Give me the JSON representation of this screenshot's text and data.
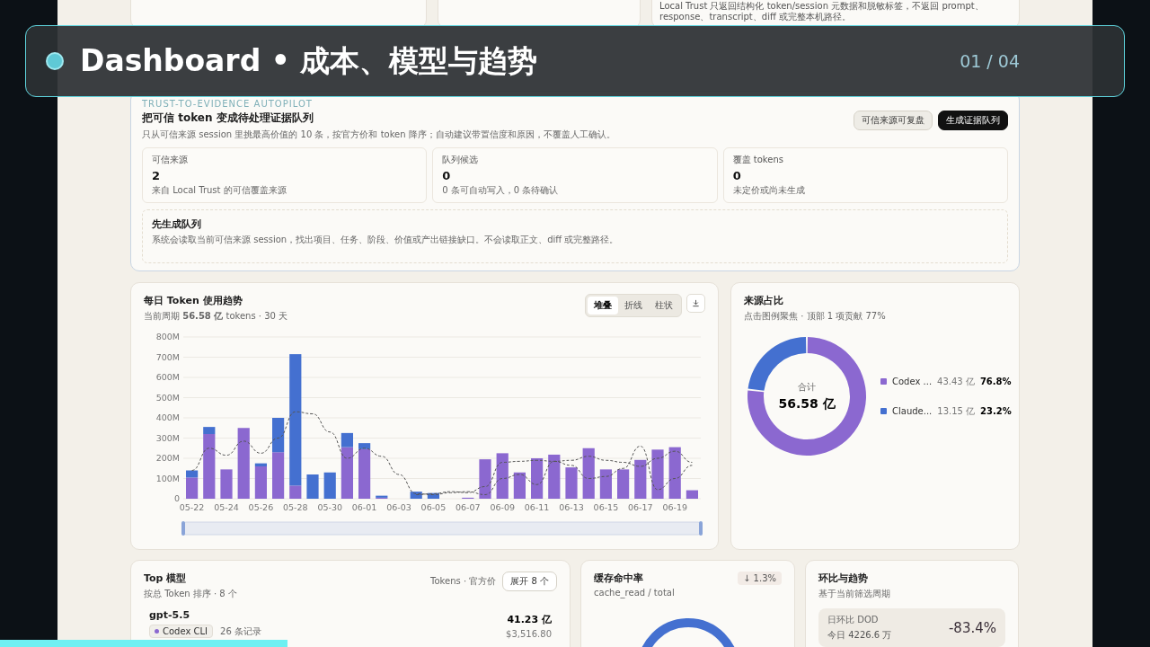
{
  "overlay": {
    "title": "Dashboard • 成本、模型与趋势",
    "counter": "01 / 04"
  },
  "top_notice": {
    "text": "Local Trust 只返回结构化 token/session 元数据和脱敏标签，不返回 prompt、response、transcript、diff 或完整本机路径。"
  },
  "autopilot": {
    "eyebrow": "TRUST-TO-EVIDENCE AUTOPILOT",
    "title": "把可信 token 变成待处理证据队列",
    "description": "只从可信来源 session 里挑最高价值的 10 条，按官方价和 token 降序；自动建议带置信度和原因，不覆盖人工确认。",
    "buttons": [
      {
        "label": "可信来源可复盘",
        "kind": "secondary"
      },
      {
        "label": "生成证据队列",
        "kind": "primary"
      }
    ],
    "stats": [
      {
        "label": "可信来源",
        "value": "2",
        "note": "来自 Local Trust 的可信覆盖来源"
      },
      {
        "label": "队列候选",
        "value": "0",
        "note": "0 条可自动写入，0 条待确认"
      },
      {
        "label": "覆盖 tokens",
        "value": "0",
        "note": "未定价或尚未生成"
      }
    ],
    "hint": {
      "title": "先生成队列",
      "text": "系统会读取当前可信来源 session，找出项目、任务、阶段、价值或产出链接缺口。不会读取正文、diff 或完整路径。"
    }
  },
  "trend": {
    "title": "每日 Token 使用趋势",
    "subtitle": "当前周期 **56.58 亿** tokens · 30 天",
    "modes": [
      {
        "label": "堆叠",
        "selected": true
      },
      {
        "label": "折线",
        "selected": false
      },
      {
        "label": "柱状",
        "selected": false
      }
    ],
    "chart_data": {
      "type": "bar",
      "stacked": true,
      "grid": true,
      "categories": [
        "05-22",
        null,
        "05-24",
        null,
        "05-26",
        null,
        "05-28",
        null,
        "05-30",
        null,
        "06-01",
        null,
        "06-03",
        null,
        "06-05",
        null,
        "06-07",
        null,
        "06-09",
        null,
        "06-11",
        null,
        "06-13",
        null,
        "06-15",
        null,
        "06-17",
        null,
        "06-19",
        null
      ],
      "series": [
        {
          "color": "#8b68d0",
          "values": [
            105,
            320,
            145,
            350,
            160,
            230,
            65,
            0,
            0,
            255,
            245,
            5,
            0,
            0,
            0,
            0,
            5,
            195,
            225,
            130,
            200,
            218,
            155,
            250,
            145,
            145,
            192,
            243,
            255,
            42
          ]
        },
        {
          "color": "#4470d0",
          "values": [
            35,
            35,
            0,
            0,
            15,
            170,
            650,
            120,
            130,
            70,
            30,
            10,
            0,
            35,
            28,
            0,
            0,
            0,
            0,
            0,
            0,
            0,
            0,
            0,
            0,
            0,
            0,
            0,
            0,
            0
          ]
        },
        {
          "type": "line",
          "line_style": "dashed",
          "color": "#555555",
          "values": [
            140,
            250,
            215,
            285,
            225,
            300,
            430,
            420,
            330,
            200,
            250,
            210,
            120,
            25,
            20,
            30,
            35,
            20,
            100,
            120,
            70,
            185,
            165,
            100,
            110,
            150,
            260,
            45,
            100,
            165
          ]
        },
        {
          "type": "line",
          "line_style": "dashed",
          "color": "#555555",
          "values": [
            null,
            null,
            null,
            null,
            null,
            null,
            null,
            null,
            null,
            null,
            null,
            null,
            null,
            20,
            25,
            35,
            30,
            60,
            180,
            185,
            190,
            185,
            190,
            210,
            190,
            180,
            160,
            200,
            235,
            180
          ]
        }
      ],
      "ylim": [
        0,
        800
      ],
      "yticks": [
        {
          "value": 0,
          "label": "0"
        },
        {
          "value": 100,
          "label": "100M"
        },
        {
          "value": 200,
          "label": "200M"
        },
        {
          "value": 300,
          "label": "300M"
        },
        {
          "value": 400,
          "label": "400M"
        },
        {
          "value": 500,
          "label": "500M"
        },
        {
          "value": 600,
          "label": "600M"
        },
        {
          "value": 700,
          "label": "700M"
        },
        {
          "value": 800,
          "label": "800M"
        }
      ]
    }
  },
  "share": {
    "title": "来源占比",
    "subtitle": "点击图例聚焦 · 顶部 1 项贡献 77%",
    "total_label": "合计",
    "total": "56.58 亿",
    "chart_data": {
      "type": "donut",
      "categories": [
        "Codex ...",
        "Claude..."
      ],
      "values": [
        76.8,
        23.2
      ]
    },
    "legend": [
      {
        "value": "43.43 亿",
        "percent": "76.8%",
        "color": "#8b68d0"
      },
      {
        "value": "13.15 亿",
        "percent": "23.2%",
        "color": "#4470d0"
      }
    ]
  },
  "top_models": {
    "title": "Top 模型",
    "subtitle": "按总 Token 排序 · 8 个",
    "meta": "Tokens · 官方价",
    "expand": "展开 8 个",
    "rows": [
      {
        "name": "gpt-5.5",
        "source": "Codex CLI",
        "color": "#8b68d0",
        "records": "26 条记录",
        "tokens": "41.23 亿",
        "cost": "$3,516.80"
      }
    ]
  },
  "cache": {
    "title": "缓存命中率",
    "subtitle": "cache_read / total",
    "delta": "↓ 1.3%"
  },
  "compare": {
    "title": "环比与趋势",
    "subtitle": "基于当前筛选周期",
    "items": [
      {
        "label": "日环比 DOD",
        "note": "今日 4226.6 万",
        "value": "-83.4%"
      }
    ]
  },
  "progress": {
    "level": 0.25
  }
}
